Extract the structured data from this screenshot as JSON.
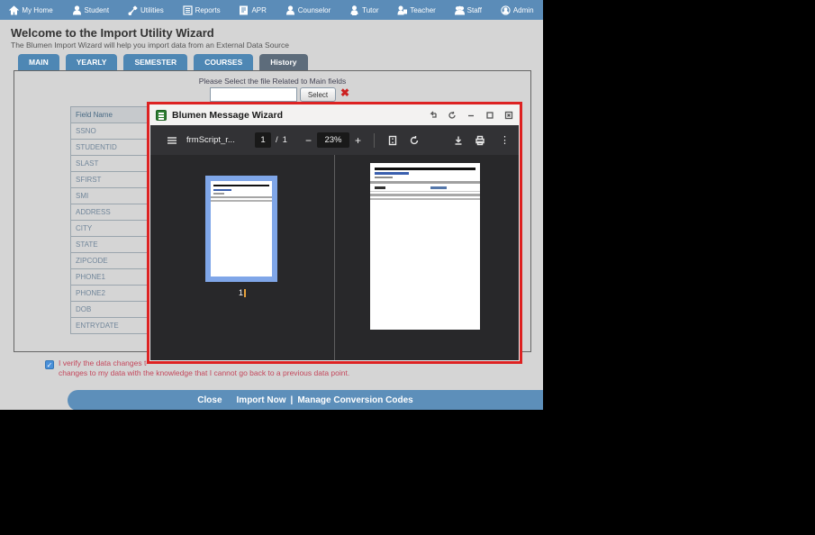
{
  "nav": {
    "items": [
      {
        "label": "My Home",
        "icon": "home-icon"
      },
      {
        "label": "Student",
        "icon": "student-icon"
      },
      {
        "label": "Utilities",
        "icon": "utilities-icon"
      },
      {
        "label": "Reports",
        "icon": "reports-icon"
      },
      {
        "label": "APR",
        "icon": "apr-icon"
      },
      {
        "label": "Counselor",
        "icon": "counselor-icon"
      },
      {
        "label": "Tutor",
        "icon": "tutor-icon"
      },
      {
        "label": "Teacher",
        "icon": "teacher-icon"
      },
      {
        "label": "Staff",
        "icon": "staff-icon"
      },
      {
        "label": "Admin",
        "icon": "admin-icon"
      }
    ]
  },
  "header": {
    "title": "Welcome to the Import Utility Wizard",
    "subtitle": "The Blumen Import Wizard will help you import data from an External Data Source"
  },
  "tabs": [
    {
      "label": "MAIN"
    },
    {
      "label": "YEARLY"
    },
    {
      "label": "SEMESTER"
    },
    {
      "label": "COURSES"
    },
    {
      "label": "History",
      "active": true
    }
  ],
  "file_select": {
    "prompt": "Please Select the file Related to Main fields",
    "input_value": "",
    "select_label": "Select",
    "clear_glyph": "✖"
  },
  "fields_table": {
    "header": "Field Name",
    "rows": [
      "SSNO",
      "STUDENTID",
      "SLAST",
      "SFIRST",
      "SMI",
      "ADDRESS",
      "CITY",
      "STATE",
      "ZIPCODE",
      "PHONE1",
      "PHONE2",
      "DOB",
      "ENTRYDATE"
    ]
  },
  "verify": {
    "checked": true,
    "check_glyph": "✓",
    "line1": "I verify the data changes to",
    "line2": "changes to my data with the knowledge that I cannot go back to a previous data point."
  },
  "footer": {
    "close_label": "Close",
    "import_label": "Import Now",
    "pipe": "|",
    "manage_label": "Manage Conversion Codes"
  },
  "modal": {
    "title": "Blumen Message Wizard",
    "pdf_toolbar": {
      "filename": "frmScript_r...",
      "page_current": "1",
      "page_separator": "/",
      "page_total": "1",
      "zoom_minus": "−",
      "zoom_level": "23%",
      "zoom_plus": "+",
      "kebab_glyph": "⋮"
    },
    "thumbnail_page_number": "1"
  },
  "colors": {
    "navbar_blue": "#5b8cb8",
    "tab_blue": "#4e87b4",
    "tab_active_slate": "#5d6c7b",
    "footer_blue": "#5d8fba",
    "modal_border_red": "#dd2222",
    "thumbnail_selection_blue": "#7fa6e8",
    "checkbox_blue": "#4a90d9",
    "verify_text_red": "#c4485c",
    "pdf_toolbar_dark": "#323235",
    "pdf_body_dark": "#28282a",
    "app_icon_green": "#2e7d32"
  }
}
